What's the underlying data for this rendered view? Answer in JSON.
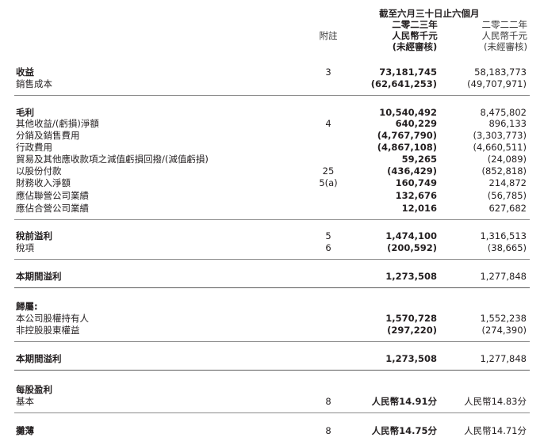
{
  "header": {
    "period": "截至六月三十日止六個月",
    "year_current": "二零二三年",
    "year_prior": "二零二二年",
    "unit_current": "人民幣千元",
    "unit_prior": "人民幣千元",
    "audit_current": "(未經審核)",
    "audit_prior": "(未經審核)",
    "note_label": "附註"
  },
  "rows": [
    {
      "label": "收益",
      "note": "3",
      "current": "73,181,745",
      "prior": "58,183,773"
    },
    {
      "label": "銷售成本",
      "note": "",
      "current": "(62,641,253)",
      "prior": "(49,707,971)"
    },
    {
      "label": "毛利",
      "note": "",
      "current": "10,540,492",
      "prior": "8,475,802"
    },
    {
      "label": "其他收益/(虧損)淨額",
      "note": "4",
      "current": "640,229",
      "prior": "896,133"
    },
    {
      "label": "分銷及銷售費用",
      "note": "",
      "current": "(4,767,790)",
      "prior": "(3,303,773)"
    },
    {
      "label": "行政費用",
      "note": "",
      "current": "(4,867,108)",
      "prior": "(4,660,511)"
    },
    {
      "label": "貿易及其他應收款項之減值虧損回撥/(減值虧損)",
      "note": "",
      "current": "59,265",
      "prior": "(24,089)"
    },
    {
      "label": "以股份付款",
      "note": "25",
      "current": "(436,429)",
      "prior": "(852,818)"
    },
    {
      "label": "財務收入淨額",
      "note": "5(a)",
      "current": "160,749",
      "prior": "214,872"
    },
    {
      "label": "應佔聯營公司業績",
      "note": "",
      "current": "132,676",
      "prior": "(56,785)"
    },
    {
      "label": "應佔合營公司業績",
      "note": "",
      "current": "12,016",
      "prior": "627,682"
    },
    {
      "label": "稅前溢利",
      "note": "5",
      "current": "1,474,100",
      "prior": "1,316,513"
    },
    {
      "label": "稅項",
      "note": "6",
      "current": "(200,592)",
      "prior": "(38,665)"
    },
    {
      "label": "本期間溢利",
      "note": "",
      "current": "1,273,508",
      "prior": "1,277,848"
    },
    {
      "label": "歸屬:",
      "note": "",
      "current": "",
      "prior": ""
    },
    {
      "label": "本公司股權持有人",
      "note": "",
      "current": "1,570,728",
      "prior": "1,552,238"
    },
    {
      "label": "非控股股東權益",
      "note": "",
      "current": "(297,220)",
      "prior": "(274,390)"
    },
    {
      "label": "本期間溢利",
      "note": "",
      "current": "1,273,508",
      "prior": "1,277,848"
    },
    {
      "label": "每股盈利",
      "note": "",
      "current": "",
      "prior": ""
    },
    {
      "label": "基本",
      "note": "8",
      "current": "人民幣14.91分",
      "prior": "人民幣14.83分"
    },
    {
      "label": "攤薄",
      "note": "8",
      "current": "人民幣14.75分",
      "prior": "人民幣14.71分"
    }
  ]
}
